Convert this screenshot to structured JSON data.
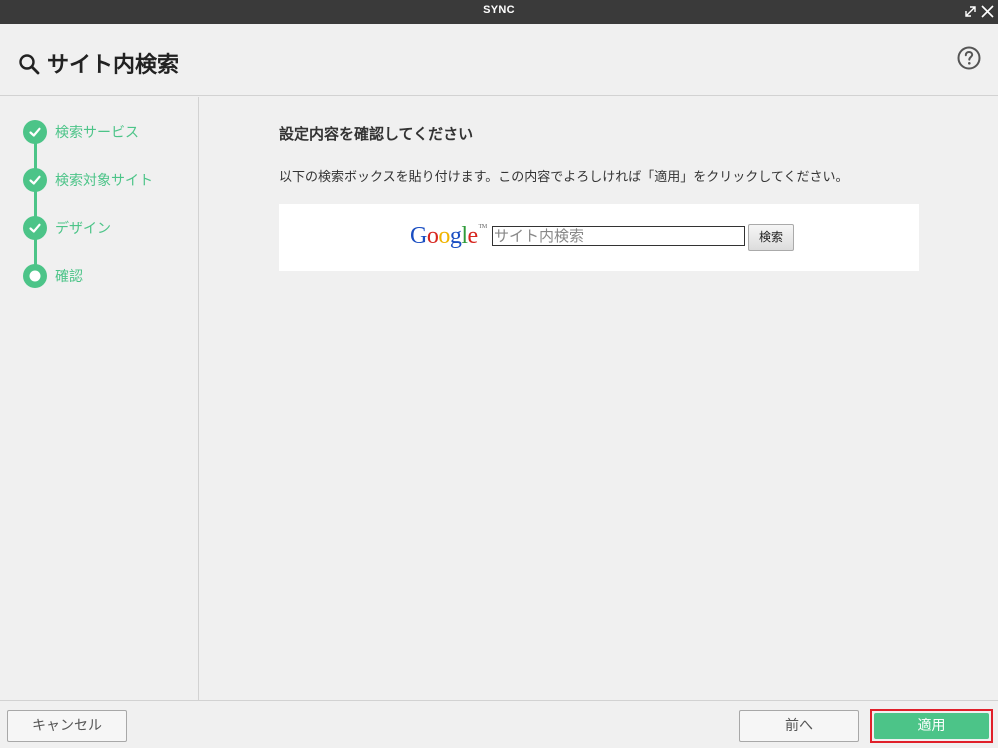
{
  "window": {
    "title": "SYNC"
  },
  "header": {
    "title": "サイト内検索"
  },
  "steps": [
    {
      "label": "検索サービス",
      "state": "done"
    },
    {
      "label": "検索対象サイト",
      "state": "done"
    },
    {
      "label": "デザイン",
      "state": "done"
    },
    {
      "label": "確認",
      "state": "current"
    }
  ],
  "main": {
    "heading": "設定内容を確認してください",
    "description": "以下の検索ボックスを貼り付けます。この内容でよろしければ「適用」をクリックしてください。",
    "preview": {
      "logo_letters": [
        "G",
        "o",
        "o",
        "g",
        "l",
        "e"
      ],
      "logo_tm": "TM",
      "search_placeholder": "サイト内検索",
      "search_button": "検索"
    }
  },
  "footer": {
    "cancel": "キャンセル",
    "prev": "前へ",
    "apply": "適用"
  },
  "colors": {
    "accent": "#4cc488",
    "titlebar": "#3a3a3a",
    "apply_highlight": "#e0202a",
    "google": [
      "#1a4ec2",
      "#d7261f",
      "#f0b400",
      "#1a4ec2",
      "#2f9b3a",
      "#d7261f"
    ]
  },
  "icons": {
    "header": "search-icon",
    "help": "help-icon",
    "step_done": "check-icon",
    "step_current": "current-dot-icon",
    "window": [
      "expand-icon",
      "close-icon"
    ]
  }
}
